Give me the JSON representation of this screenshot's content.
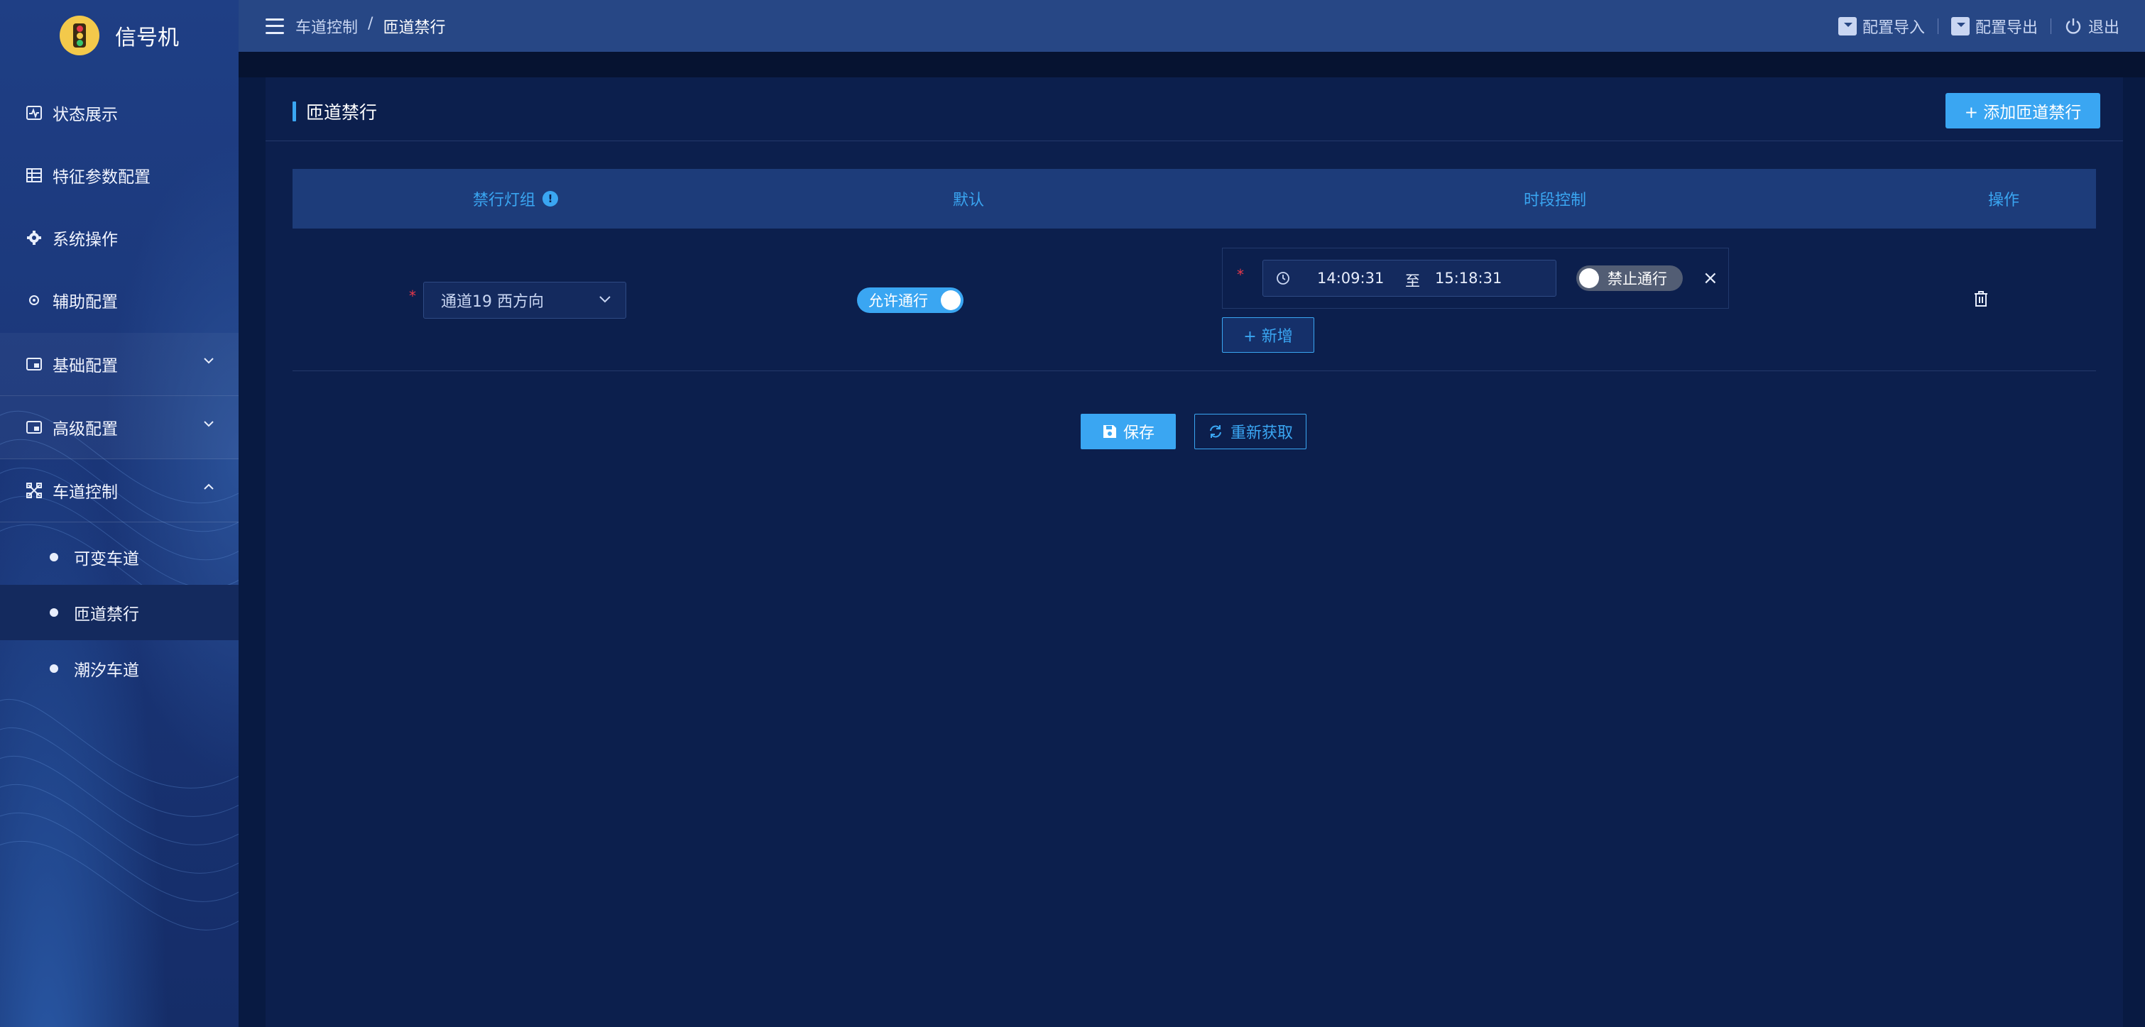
{
  "app": {
    "title": "信号机"
  },
  "sidebar": {
    "items": [
      {
        "label": "状态展示",
        "icon": "pulse-icon"
      },
      {
        "label": "特征参数配置",
        "icon": "table-icon"
      },
      {
        "label": "系统操作",
        "icon": "gear-icon"
      },
      {
        "label": "辅助配置",
        "icon": "cog-small-icon"
      },
      {
        "label": "基础配置",
        "icon": "config-icon"
      },
      {
        "label": "高级配置",
        "icon": "config-icon"
      },
      {
        "label": "车道控制",
        "icon": "lanes-icon"
      }
    ],
    "sub_items": [
      {
        "label": "可变车道"
      },
      {
        "label": "匝道禁行"
      },
      {
        "label": "潮汐车道"
      }
    ]
  },
  "header": {
    "breadcrumb": [
      "车道控制",
      "/",
      "匝道禁行"
    ],
    "import_label": "配置导入",
    "export_label": "配置导出",
    "logout_label": "退出"
  },
  "panel": {
    "title": "匝道禁行",
    "add_label": "+ 添加匝道禁行"
  },
  "table": {
    "headers": [
      "禁行灯组",
      "默认",
      "时段控制",
      "操作"
    ],
    "info_glyph": "!",
    "row": {
      "channel": "通道19 西方向",
      "default_label": "允许通行",
      "start_time": "14:09:31",
      "to_label": "至",
      "end_time": "15:18:31",
      "period_label": "禁止通行",
      "add_period_label": "+ 新增",
      "required_mark": "*"
    }
  },
  "actions": {
    "save_label": "保存",
    "refresh_label": "重新获取"
  },
  "colors": {
    "accent": "#3aa6f2",
    "background": "#0c1f4d",
    "sidebar": "#1d3a7e"
  }
}
